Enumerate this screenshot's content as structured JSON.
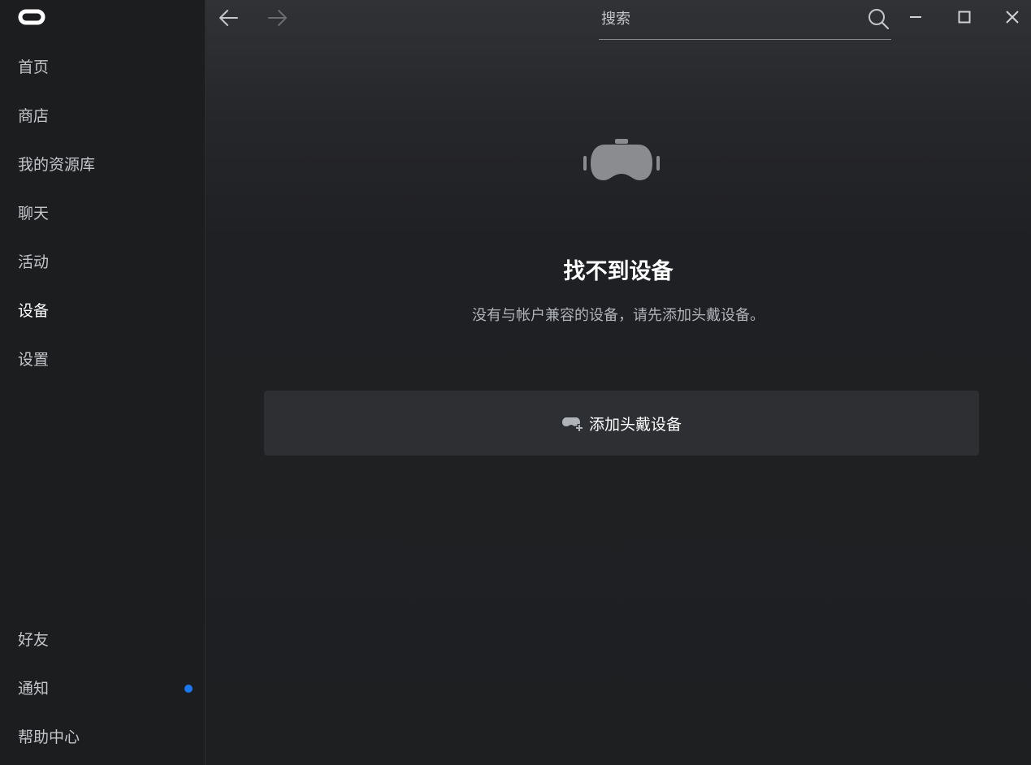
{
  "sidebar": {
    "logo": "oculus-logo",
    "top_items": [
      {
        "label": "首页",
        "active": false
      },
      {
        "label": "商店",
        "active": false
      },
      {
        "label": "我的资源库",
        "active": false
      },
      {
        "label": "聊天",
        "active": false
      },
      {
        "label": "活动",
        "active": false
      },
      {
        "label": "设备",
        "active": true
      },
      {
        "label": "设置",
        "active": false
      }
    ],
    "bottom_items": [
      {
        "label": "好友"
      },
      {
        "label": "通知",
        "badge": "unread-dot"
      },
      {
        "label": "帮助中心"
      }
    ]
  },
  "topbar": {
    "back_icon": "arrow-left-icon",
    "forward_icon": "arrow-right-icon",
    "search": {
      "value": "",
      "placeholder": "搜索",
      "icon": "search-icon"
    },
    "window_controls": [
      "minimize-icon",
      "maximize-icon",
      "close-icon"
    ]
  },
  "content": {
    "hero_icon": "vr-headset-icon",
    "title": "找不到设备",
    "subtitle": "没有与帐户兼容的设备，请先添加头戴设备。",
    "add_button": {
      "label": "添加头戴设备",
      "icon": "add-headset-icon"
    }
  },
  "colors": {
    "background": "#1e1f21",
    "sidebar": "#1c1d1f",
    "button": "#2e2f32",
    "notification_dot": "#1877f2"
  }
}
